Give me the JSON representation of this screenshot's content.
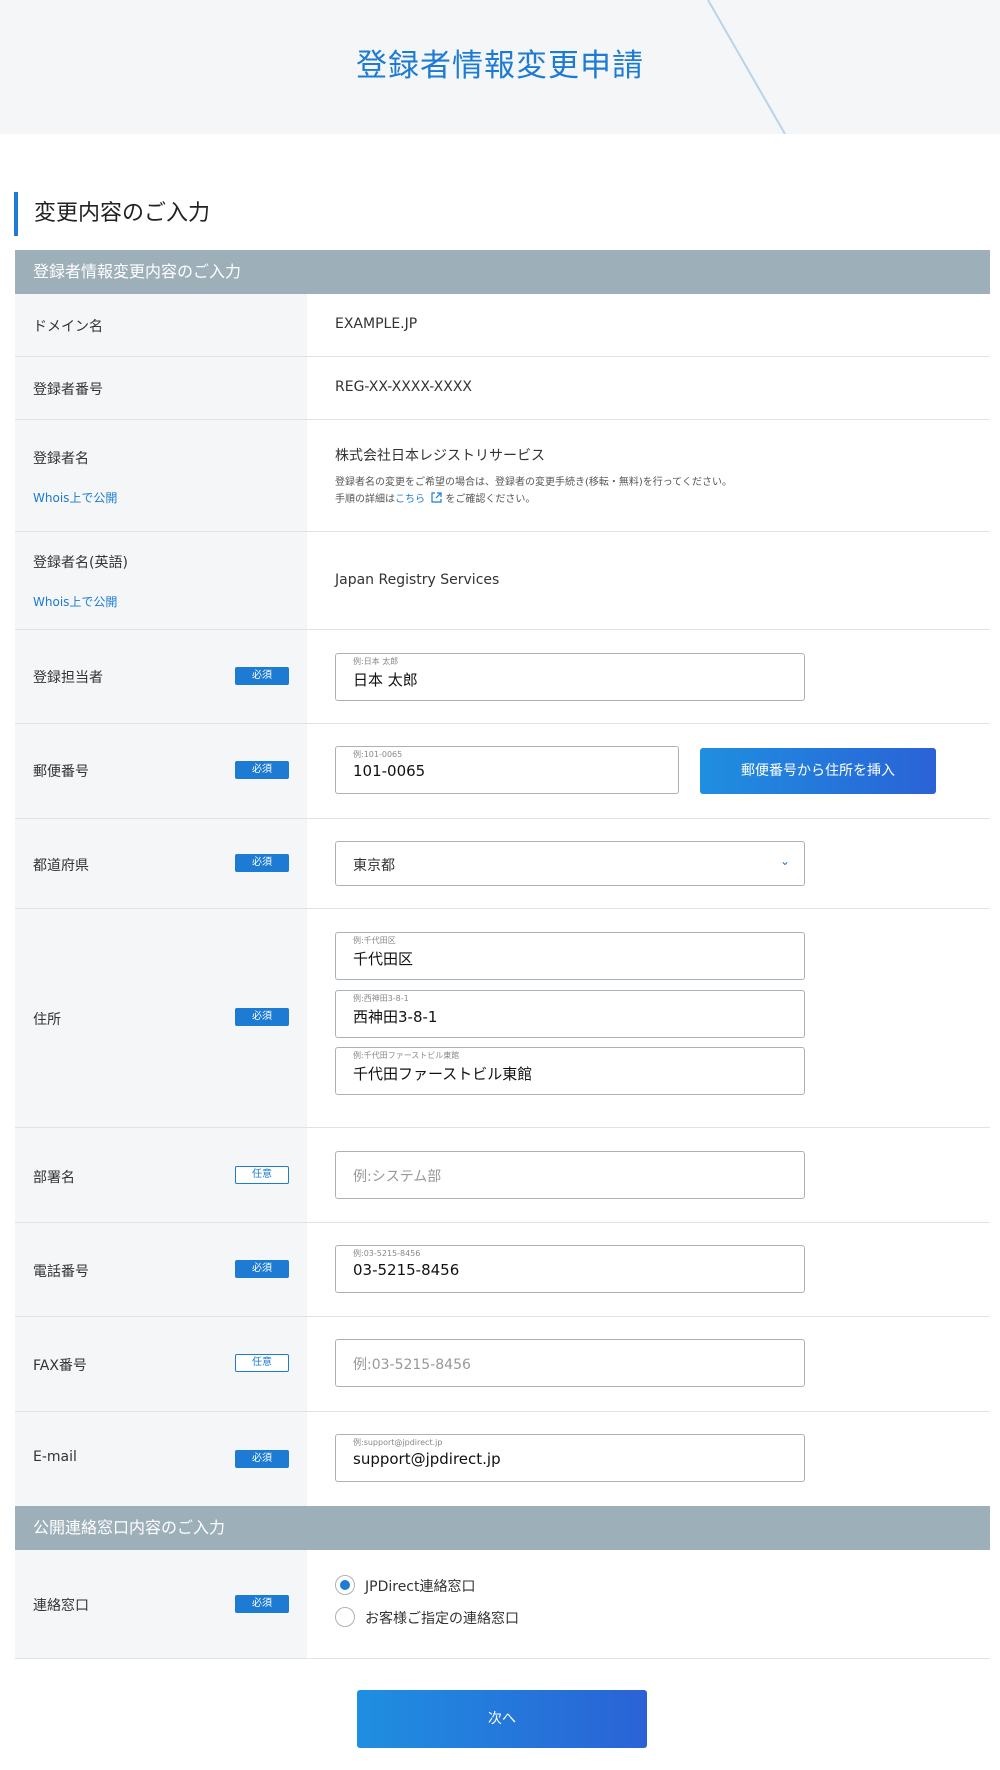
{
  "page": {
    "title": "登録者情報変更申請"
  },
  "section": {
    "title": "変更内容のご入力"
  },
  "registrant_band": "登録者情報変更内容のご入力",
  "contact_band": "公開連絡窓口内容のご入力",
  "badges": {
    "required": "必須",
    "optional": "任意"
  },
  "whois_public": "Whois上で公開",
  "rows": {
    "domain": {
      "label": "ドメイン名",
      "value": "EXAMPLE.JP"
    },
    "reg_no": {
      "label": "登録者番号",
      "value": "REG-XX-XXXX-XXXX"
    },
    "reg_name": {
      "label": "登録者名",
      "value": "株式会社日本レジストリサービス",
      "note_line1": "登録者名の変更をご希望の場合は、登録者の変更手続き(移転・無料)を行ってください。",
      "note_line2_pre": "手順の詳細は",
      "note_link": "こちら",
      "note_line2_post": " をご確認ください。"
    },
    "reg_name_en": {
      "label": "登録者名(英語)",
      "value": "Japan Registry Services"
    },
    "person": {
      "label": "登録担当者",
      "hint": "例:日本 太郎",
      "value": "日本 太郎"
    },
    "zip": {
      "label": "郵便番号",
      "hint": "例:101-0065",
      "value": "101-0065",
      "button": "郵便番号から住所を挿入"
    },
    "pref": {
      "label": "都道府県",
      "value": "東京都"
    },
    "address": {
      "label": "住所",
      "line1_hint": "例:千代田区",
      "line1": "千代田区",
      "line2_hint": "例:西神田3-8-1",
      "line2": "西神田3-8-1",
      "line3_hint": "例:千代田ファーストビル東館",
      "line3": "千代田ファーストビル東館"
    },
    "dept": {
      "label": "部署名",
      "placeholder": "例:システム部"
    },
    "tel": {
      "label": "電話番号",
      "hint": "例:03-5215-8456",
      "value": "03-5215-8456"
    },
    "fax": {
      "label": "FAX番号",
      "placeholder": "例:03-5215-8456"
    },
    "email": {
      "label": "E-mail",
      "hint": "例:support@jpdirect.jp",
      "value": "support@jpdirect.jp"
    },
    "contact": {
      "label": "連絡窓口",
      "option1": "JPDirect連絡窓口",
      "option2": "お客様ご指定の連絡窓口",
      "selected": "option1"
    }
  },
  "next_button": "次へ",
  "colors": {
    "accent": "#1d7bd3",
    "band": "#9dafb9",
    "label_bg": "#f4f6f8"
  }
}
